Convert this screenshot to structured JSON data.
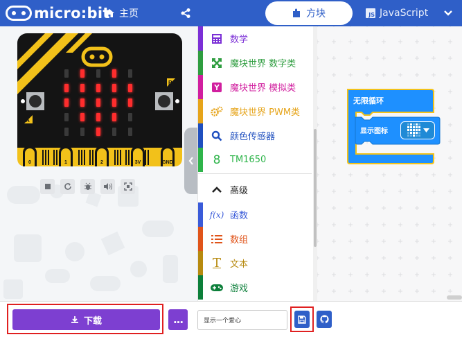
{
  "header": {
    "logo_text": "micro:bit",
    "home_label": "主页",
    "tabs": [
      {
        "label": "方块",
        "active": true
      },
      {
        "label": "JavaScript",
        "active": false
      }
    ]
  },
  "simulator": {
    "pins": [
      "0",
      "1",
      "2",
      "3V",
      "GND"
    ],
    "button_a": "A",
    "button_b": "B",
    "led_matrix_lit": [
      [
        0,
        1,
        0,
        1,
        0
      ],
      [
        1,
        1,
        1,
        1,
        1
      ],
      [
        1,
        1,
        1,
        1,
        1
      ],
      [
        0,
        1,
        1,
        1,
        0
      ],
      [
        0,
        0,
        1,
        0,
        0
      ]
    ],
    "controls": [
      "stop-icon",
      "restart-icon",
      "debug-icon",
      "sound-icon",
      "fullscreen-icon"
    ]
  },
  "toolbox": {
    "items": [
      {
        "label": "数学",
        "color": "#7b2fd6",
        "icon": "calculator-icon"
      },
      {
        "label": "魔块世界 数字类",
        "color": "#2e9d3f",
        "icon": "shuffle-icon"
      },
      {
        "label": "魔块世界 模拟类",
        "color": "#d11f9f",
        "icon": "y-icon"
      },
      {
        "label": "魔块世界 PWM类",
        "color": "#e6a41a",
        "icon": "gears-icon"
      },
      {
        "label": "颜色传感器",
        "color": "#1f4fbf",
        "icon": "search-icon"
      },
      {
        "label": "TM1650",
        "color": "#2eb44a",
        "icon": "digit-eight-icon"
      },
      {
        "label": "高级",
        "color": "#222222",
        "icon": "chevron-up-icon"
      },
      {
        "label": "函数",
        "color": "#3a5bd9",
        "icon": "function-icon"
      },
      {
        "label": "数组",
        "color": "#e0541a",
        "icon": "list-icon"
      },
      {
        "label": "文本",
        "color": "#b78a0f",
        "icon": "text-icon"
      },
      {
        "label": "游戏",
        "color": "#0c7f3a",
        "icon": "gamepad-icon"
      }
    ]
  },
  "workspace": {
    "loop_block_label": "无限循环",
    "show_icon_label": "显示图标",
    "block_color": "#1e90ff"
  },
  "bottom": {
    "download_label": "下载",
    "more_label": "...",
    "project_name": "显示一个爱心"
  },
  "colors": {
    "header_bg": "#2f5fc8",
    "download_bg": "#7d3fd1",
    "highlight_border": "#e02020"
  }
}
